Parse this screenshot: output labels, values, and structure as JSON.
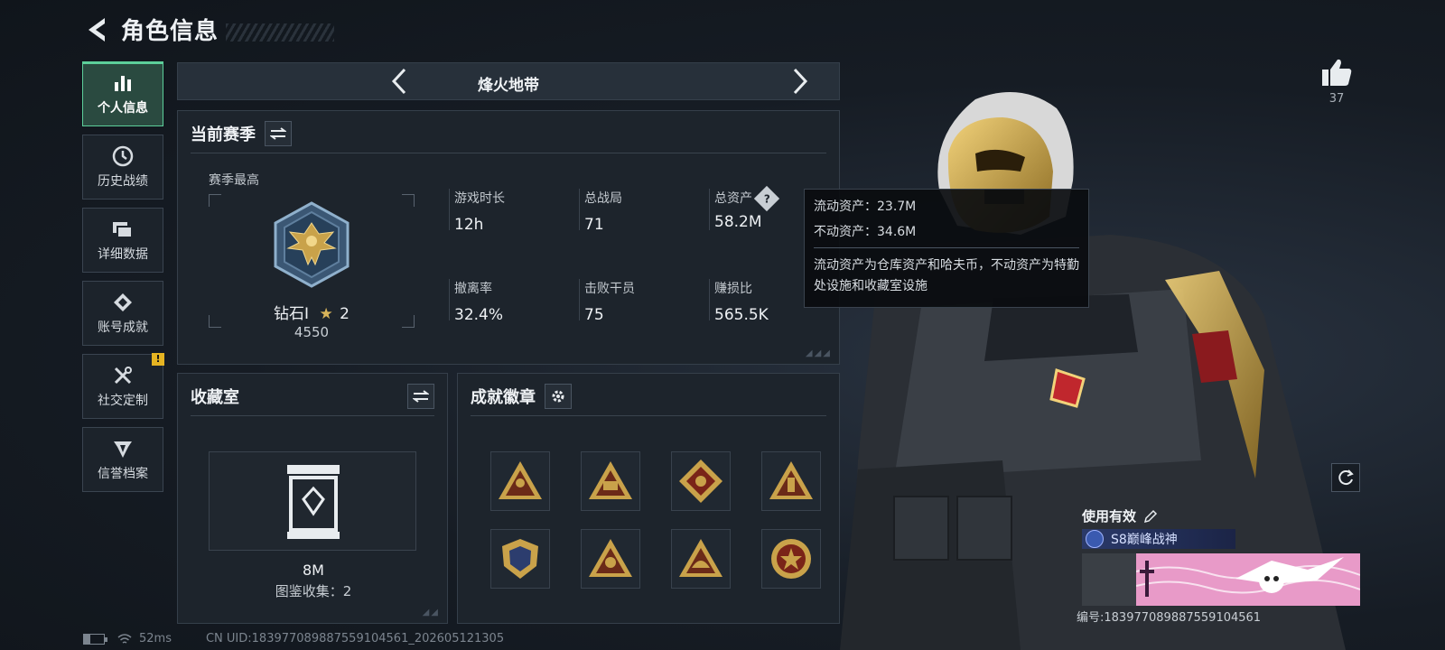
{
  "header": {
    "title": "角色信息"
  },
  "sidebar": {
    "items": [
      {
        "label": "个人信息",
        "icon": "bar-chart-icon",
        "active": true
      },
      {
        "label": "历史战绩",
        "icon": "clock-icon"
      },
      {
        "label": "详细数据",
        "icon": "cards-icon"
      },
      {
        "label": "账号成就",
        "icon": "diamond-badge-icon"
      },
      {
        "label": "社交定制",
        "icon": "tools-icon",
        "badge": "!"
      },
      {
        "label": "信誉档案",
        "icon": "shield-wing-icon"
      }
    ]
  },
  "mode": {
    "title": "烽火地带"
  },
  "season": {
    "title": "当前赛季",
    "sub_label": "赛季最高",
    "rank_name": "钻石I",
    "rank_stars": "2",
    "rank_points": "4550",
    "stats": [
      {
        "label": "游戏时长",
        "value": "12h"
      },
      {
        "label": "总战局",
        "value": "71"
      },
      {
        "label": "总资产",
        "value": "58.2M"
      },
      {
        "label": "撤离率",
        "value": "32.4%"
      },
      {
        "label": "击败干员",
        "value": "75"
      },
      {
        "label": "赚损比",
        "value": "565.5K"
      }
    ]
  },
  "tooltip": {
    "liquid": "流动资产：23.7M",
    "fixed": "不动资产：34.6M",
    "desc": "流动资产为仓库资产和哈夫币，不动资产为特勤处设施和收藏室设施"
  },
  "collection": {
    "title": "收藏室",
    "value": "8M",
    "count": "图鉴收集：2"
  },
  "badges": {
    "title": "成就徽章",
    "items": [
      "soldier-badge-icon",
      "s8-badge-icon",
      "dragon-badge-icon",
      "bottle-badge-icon",
      "crest-badge-icon",
      "rider-badge-icon",
      "helmet-badge-icon",
      "star-badge-icon"
    ]
  },
  "profile": {
    "likes": "37",
    "card_label": "使用有效",
    "card_title": "S8巅峰战神",
    "serial": "编号:1839770898875591045​61"
  },
  "status": {
    "ping": "52ms",
    "uid": "CN UID:18397708988755910​4561_202605121305"
  },
  "colors": {
    "accent": "#5ccf9a",
    "gold": "#c9a24a",
    "warning": "#e6b422"
  }
}
